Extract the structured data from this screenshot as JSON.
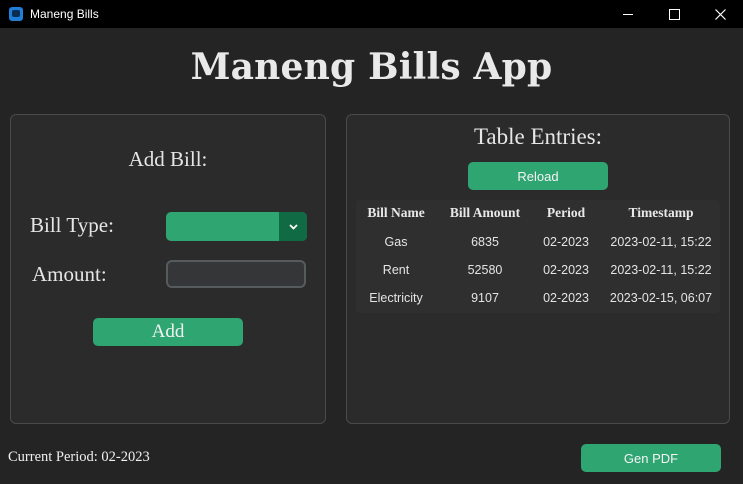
{
  "window": {
    "title": "Maneng Bills"
  },
  "app": {
    "heading": "Maneng Bills App"
  },
  "add_bill": {
    "title": "Add Bill:",
    "bill_type_label": "Bill Type:",
    "bill_type_value": "",
    "amount_label": "Amount:",
    "amount_value": "",
    "add_label": "Add"
  },
  "table": {
    "title": "Table Entries:",
    "reload_label": "Reload",
    "columns": [
      "Bill Name",
      "Bill Amount",
      "Period",
      "Timestamp"
    ],
    "rows": [
      [
        "Gas",
        "6835",
        "02-2023",
        "2023-02-11, 15:22"
      ],
      [
        "Rent",
        "52580",
        "02-2023",
        "2023-02-11, 15:22"
      ],
      [
        "Electricity",
        "9107",
        "02-2023",
        "2023-02-15, 06:07"
      ]
    ]
  },
  "footer": {
    "current_period": "Current Period: 02-2023",
    "gen_pdf_label": "Gen PDF"
  },
  "colors": {
    "accent": "#2fa572",
    "accent_dark": "#106a43",
    "background": "#242424",
    "panel": "#2b2b2b"
  }
}
